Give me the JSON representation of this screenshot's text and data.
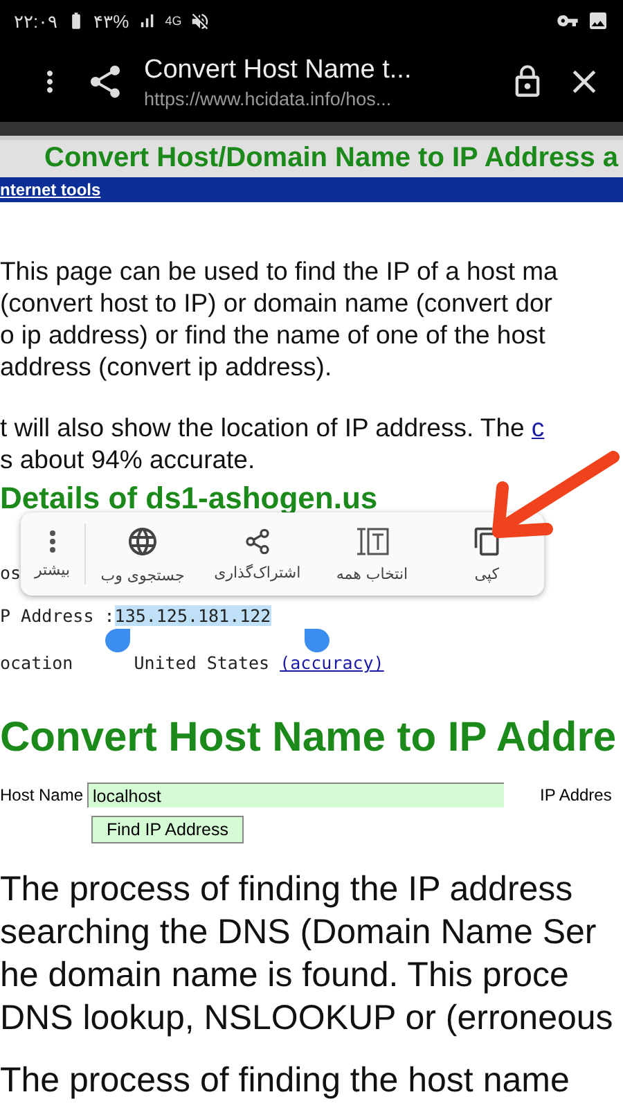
{
  "status_bar": {
    "time": "۲۲:۰۹",
    "battery": "۴۳%",
    "network": "4G"
  },
  "toolbar": {
    "title": "Convert Host Name t...",
    "url": "https://www.hcidata.info/hos..."
  },
  "page": {
    "banner": "Convert Host/Domain Name to IP Address a",
    "nav_link": "nternet tools",
    "intro_lines": [
      "This page can be used to find the IP of a host ma",
      "(convert host to IP) or domain name (convert dor",
      "o ip address) or find the name of one of the host",
      "address (convert ip address)."
    ],
    "accuracy_line": {
      "text": "t will also show the location of IP address. The ",
      "link": "c"
    },
    "accuracy_line_2": "s about 94% accurate.",
    "details_heading": "Details of ds1-ashogen.us",
    "details": {
      "host_label": "os",
      "ip_label": "P Address : ",
      "ip_value": "135.125.181.122",
      "location_label": "ocation",
      "location_value": "United States",
      "accuracy_link": "(accuracy)"
    },
    "form_heading": "Convert Host Name to IP Addre",
    "form": {
      "host_label": "Host Name",
      "host_value": "localhost",
      "ip_label": "IP Addres",
      "button": "Find IP Address"
    },
    "process_lines": [
      "The process of finding the IP address",
      "searching the DNS (Domain Name Ser",
      "he domain name is found. This proce",
      "DNS lookup, NSLOOKUP or (erroneous"
    ],
    "last_line": "The process of finding the host name"
  },
  "selection_menu": [
    {
      "kind": "copy",
      "label": "کپی"
    },
    {
      "kind": "selectall",
      "label": "انتخاب همه"
    },
    {
      "kind": "share",
      "label": "اشتراک‌گذاری"
    },
    {
      "kind": "web",
      "label": "جستجوی وب"
    },
    {
      "kind": "more",
      "label": "بیشتر"
    }
  ]
}
